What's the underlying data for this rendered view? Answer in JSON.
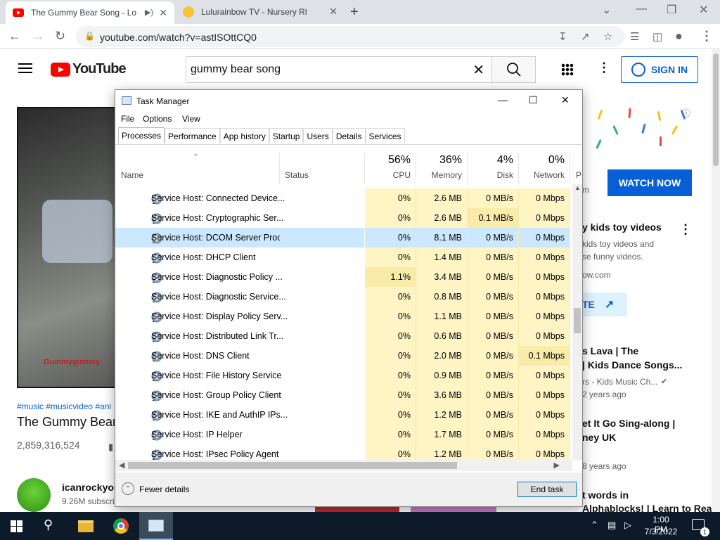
{
  "browser": {
    "tabs": [
      {
        "title": "The Gummy Bear Song - Lon",
        "active": true
      },
      {
        "title": "Lulurainbow TV - Nursery Rhyme",
        "active": false
      }
    ],
    "url": "youtube.com/watch?v=astISOttCQ0"
  },
  "youtube": {
    "logo_text": "YouTube",
    "search_value": "gummy bear song",
    "signin_label": "SIGN IN",
    "tags": "#music #musicvideo #ani",
    "video_title": "The Gummy Bear",
    "views": "2,859,316,524",
    "player_caption": "Gummygummy",
    "channel": {
      "name": "icanrockyou",
      "subs": "9.26M subscri"
    },
    "ad": {
      "watch_now": "WATCH NOW",
      "url_tail": "m",
      "title": "y kids toy videos",
      "desc1": "kids toy videos and",
      "desc2": "se funny videos.",
      "domain": "ow.com",
      "visit": "TE"
    },
    "related": [
      {
        "title1": "s Lava | The",
        "title2": "| Kids Dance Songs...",
        "meta1": "rs - Kids Music Ch...",
        "meta2": "2 years ago"
      },
      {
        "title1": "et It Go Sing-along |",
        "title2": "ney UK",
        "meta1": "8 years ago"
      },
      {
        "title1": "t words in",
        "title2": "Alphablocks! | Learn to Read |..."
      }
    ]
  },
  "taskmanager": {
    "title": "Task Manager",
    "menu": [
      "File",
      "Options",
      "View"
    ],
    "tabs": [
      "Processes",
      "Performance",
      "App history",
      "Startup",
      "Users",
      "Details",
      "Services"
    ],
    "active_tab": "Processes",
    "columns": {
      "name": "Name",
      "status": "Status",
      "cpu": {
        "pct": "56%",
        "label": "CPU"
      },
      "memory": {
        "pct": "36%",
        "label": "Memory"
      },
      "disk": {
        "pct": "4%",
        "label": "Disk"
      },
      "network": {
        "pct": "0%",
        "label": "Network"
      },
      "power_partial": "P"
    },
    "rows": [
      {
        "name": "Service Host: Connected Device...",
        "cpu": "0%",
        "mem": "2.6 MB",
        "disk": "0 MB/s",
        "net": "0 Mbps"
      },
      {
        "name": "Service Host: Cryptographic Ser...",
        "cpu": "0%",
        "mem": "2.6 MB",
        "disk": "0.1 MB/s",
        "net": "0 Mbps"
      },
      {
        "name": "Service Host: DCOM Server Proc...",
        "cpu": "0%",
        "mem": "8.1 MB",
        "disk": "0 MB/s",
        "net": "0 Mbps",
        "selected": true
      },
      {
        "name": "Service Host: DHCP Client",
        "cpu": "0%",
        "mem": "1.4 MB",
        "disk": "0 MB/s",
        "net": "0 Mbps"
      },
      {
        "name": "Service Host: Diagnostic Policy ...",
        "cpu": "1.1%",
        "mem": "3.4 MB",
        "disk": "0 MB/s",
        "net": "0 Mbps"
      },
      {
        "name": "Service Host: Diagnostic Service...",
        "cpu": "0%",
        "mem": "0.8 MB",
        "disk": "0 MB/s",
        "net": "0 Mbps"
      },
      {
        "name": "Service Host: Display Policy Serv...",
        "cpu": "0%",
        "mem": "1.1 MB",
        "disk": "0 MB/s",
        "net": "0 Mbps"
      },
      {
        "name": "Service Host: Distributed Link Tr...",
        "cpu": "0%",
        "mem": "0.6 MB",
        "disk": "0 MB/s",
        "net": "0 Mbps"
      },
      {
        "name": "Service Host: DNS Client",
        "cpu": "0%",
        "mem": "2.0 MB",
        "disk": "0 MB/s",
        "net": "0.1 Mbps"
      },
      {
        "name": "Service Host: File History Service",
        "cpu": "0%",
        "mem": "0.9 MB",
        "disk": "0 MB/s",
        "net": "0 Mbps"
      },
      {
        "name": "Service Host: Group Policy Client",
        "cpu": "0%",
        "mem": "3.6 MB",
        "disk": "0 MB/s",
        "net": "0 Mbps"
      },
      {
        "name": "Service Host: IKE and AuthIP IPs...",
        "cpu": "0%",
        "mem": "1.2 MB",
        "disk": "0 MB/s",
        "net": "0 Mbps"
      },
      {
        "name": "Service Host: IP Helper",
        "cpu": "0%",
        "mem": "1.7 MB",
        "disk": "0 MB/s",
        "net": "0 Mbps"
      },
      {
        "name": "Service Host: IPsec Policy Agent",
        "cpu": "0%",
        "mem": "1.2 MB",
        "disk": "0 MB/s",
        "net": "0 Mbps"
      }
    ],
    "fewer_details": "Fewer details",
    "end_task": "End task"
  },
  "taskbar": {
    "time": "1:00 PM",
    "date": "7/3/2022",
    "notification_count": "1"
  }
}
